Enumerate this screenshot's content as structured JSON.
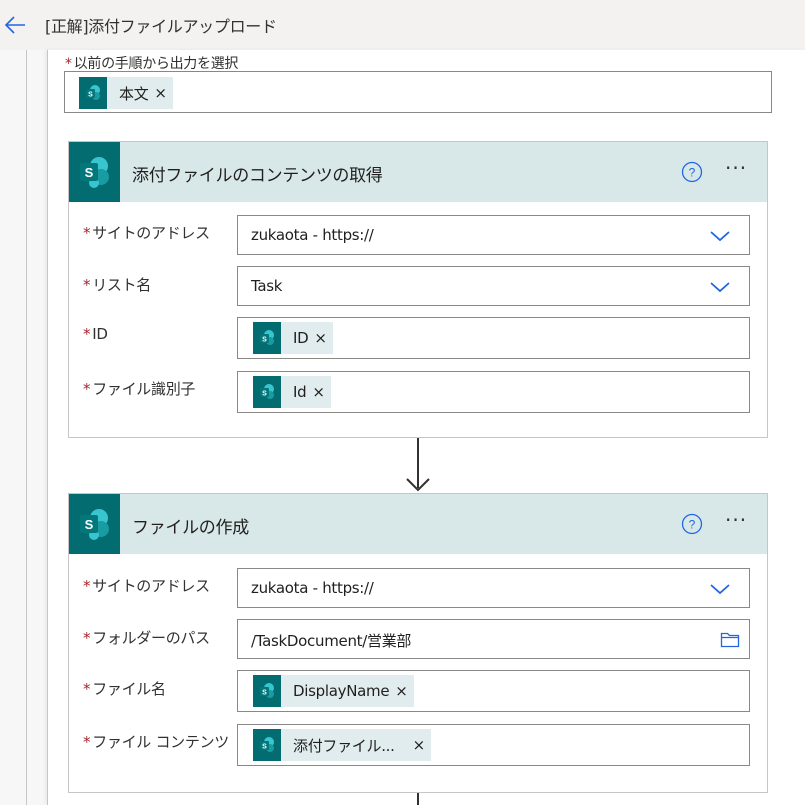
{
  "header": {
    "title": "[正解]添付ファイルアップロード"
  },
  "select_output": {
    "label": "以前の手順から出力を選択",
    "required_mark": "*",
    "token": "本文",
    "token_remove": "×"
  },
  "action1": {
    "title": "添付ファイルのコンテンツの取得",
    "help_icon": "help-circle-icon",
    "more_icon": "more-horizontal-icon",
    "more_label": "···",
    "fields": {
      "site": {
        "label": "サイトのアドレス",
        "value": "zukaota - https://"
      },
      "list": {
        "label": "リスト名",
        "value": "Task"
      },
      "id": {
        "label": "ID",
        "token": "ID"
      },
      "file_id": {
        "label": "ファイル識別子",
        "token": "Id"
      }
    }
  },
  "action2": {
    "title": "ファイルの作成",
    "help_icon": "help-circle-icon",
    "more_icon": "more-horizontal-icon",
    "more_label": "···",
    "fields": {
      "site": {
        "label": "サイトのアドレス",
        "value": "zukaota - https://"
      },
      "folder": {
        "label": "フォルダーのパス",
        "value": "/TaskDocument/営業部"
      },
      "name": {
        "label": "ファイル名",
        "token": "DisplayName"
      },
      "content": {
        "label": "ファイル コンテンツ",
        "token": "添付ファイル..."
      }
    }
  },
  "token_remove": "×",
  "colors": {
    "sharepoint_teal": "#036c70",
    "header_bg": "#d8e8e9",
    "token_bg": "#e1ecee",
    "required_red": "#a4262c",
    "accent_blue": "#2266e3"
  }
}
